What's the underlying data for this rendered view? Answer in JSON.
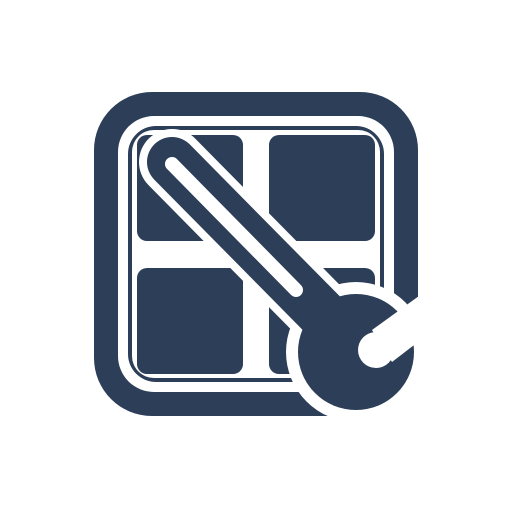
{
  "icon": {
    "name": "app-grid-settings-icon",
    "description_name": "grid-with-wrench-icon",
    "background_color": "#ffffff",
    "primary_color": "#2c3e58",
    "gap_color": "#ffffff"
  }
}
